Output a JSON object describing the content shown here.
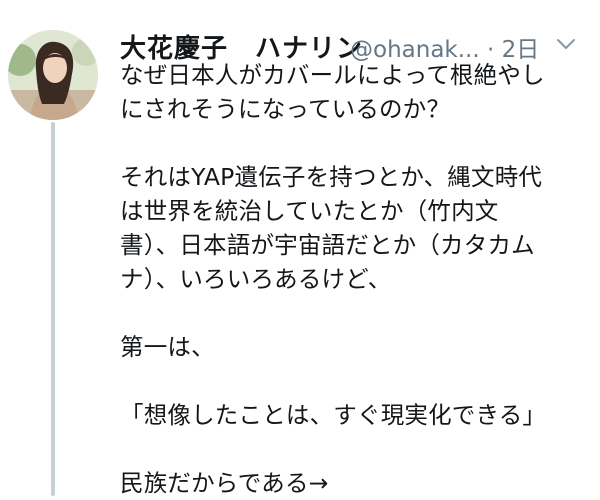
{
  "tweet": {
    "display_name": "大花慶子　ハナリン",
    "handle": "@ohanak...",
    "time": "· 2日",
    "menu_icon": "chevron-down-icon",
    "avatar_icon": "user-avatar",
    "lines": [
      "なぜ日本人がカバールによって根絶やし",
      "にされそうになっているのか？",
      "",
      "それはYAP遺伝子を持つとか、縄文時代",
      "は世界を統治していたとか（竹内文",
      "書）、日本語が宇宙語だとか（カタカム",
      "ナ）、いろいろあるけど、",
      "",
      "第一は、",
      "",
      "「想像したことは、すぐ現実化できる」",
      "",
      "民族だからである→"
    ]
  },
  "colors": {
    "text": "#14171a",
    "secondary": "#657786",
    "thread_line": "#c4cfd6"
  }
}
